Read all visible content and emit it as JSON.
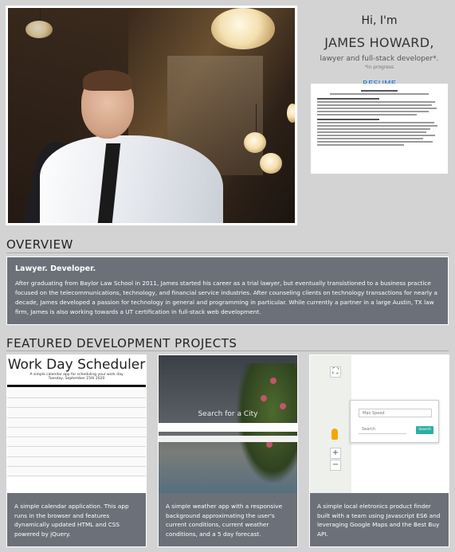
{
  "intro": {
    "greeting": "Hi, I'm",
    "name": "JAMES HOWARD,",
    "role": "lawyer and full-stack developer*.",
    "progress_note": "*in progress",
    "resume_link": "RESUME"
  },
  "overview": {
    "heading": "OVERVIEW",
    "subtitle": "Lawyer. Developer.",
    "body": "After graduating from Baylor Law School in 2011, James started his career as a trial lawyer, but eventually transistioned to a business practice focused on the telecommunications, technology, and financial service industries. After counseling clients on technology transactions for nearly a decade, James developed a passion for technology in general and programming in particular. While currently a partner in a large Austin, TX law firm, James is also working towards a UT certification in full-stack web development."
  },
  "projects": {
    "heading": "FEATURED DEVELOPMENT PROJECTS",
    "items": [
      {
        "screenshot_title": "Work Day Scheduler",
        "screenshot_subtitle": "A simple calendar app for scheduling your work day",
        "screenshot_date": "Tuesday, September 15th 2020",
        "description": "A simple calendar application. This app runs in the browser and features dynamically updated HTML and CSS powered by jQuery."
      },
      {
        "screenshot_label": "Search for a City",
        "description": "A simple weather app with a responsive background approximating the user's current conditions, current weather conditions, and a 5 day forecast."
      },
      {
        "field_1": "Max Speed",
        "field_2": "Search",
        "button": "Search",
        "description": "A simple local eletronics product finder built with a team using Javascript ES6 and leveraging Google Maps and the Best Buy API."
      }
    ]
  },
  "colors": {
    "page_background": "#d3d3d3",
    "card_background": "#6b7079",
    "link": "#2a73d8",
    "finder_button": "#2bb0a2"
  }
}
